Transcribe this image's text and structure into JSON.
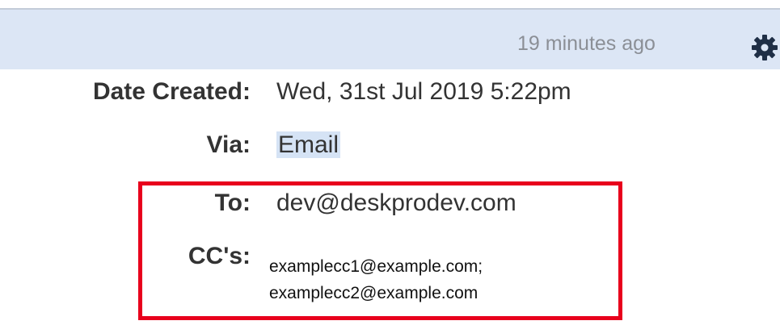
{
  "header": {
    "timestamp": "19 minutes ago",
    "settings_icon": "gear-icon"
  },
  "details": {
    "date_created_label": "Date Created:",
    "date_created_value": "Wed, 31st Jul 2019 5:22pm",
    "via_label": "Via:",
    "via_value": "Email",
    "to_label": "To:",
    "to_value": "dev@deskprodev.com",
    "cc_label": "CC's:",
    "cc_values": [
      "examplecc1@example.com;",
      "examplecc2@example.com"
    ]
  },
  "colors": {
    "header_bg": "#dce6f5",
    "highlight": "#d5e3f5",
    "callout_border": "#e8001c"
  }
}
